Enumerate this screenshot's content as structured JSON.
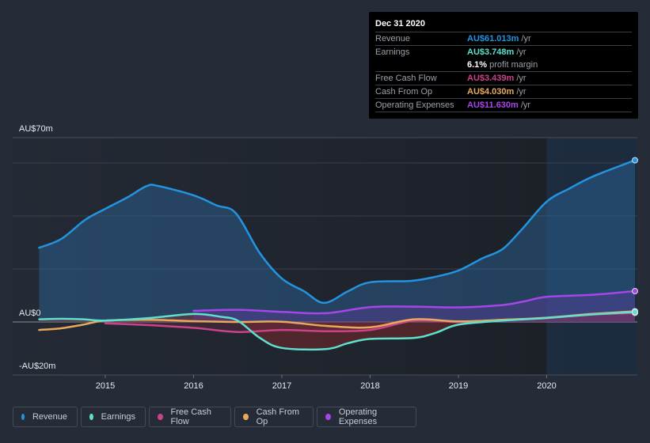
{
  "tooltip": {
    "date": "Dec 31 2020",
    "rows": [
      {
        "label": "Revenue",
        "value": "AU$61.013m",
        "unit": "/yr",
        "color": "#2394df"
      },
      {
        "label": "Earnings",
        "value": "AU$3.748m",
        "unit": "/yr",
        "color": "#5fe0cf"
      },
      {
        "label": "",
        "margin_value": "6.1%",
        "margin_label": "profit margin"
      },
      {
        "label": "Free Cash Flow",
        "value": "AU$3.439m",
        "unit": "/yr",
        "color": "#c9428a"
      },
      {
        "label": "Cash From Op",
        "value": "AU$4.030m",
        "unit": "/yr",
        "color": "#e8a95c"
      },
      {
        "label": "Operating Expenses",
        "value": "AU$11.630m",
        "unit": "/yr",
        "color": "#a646e8"
      }
    ]
  },
  "legend": [
    {
      "label": "Revenue",
      "color": "#2394df"
    },
    {
      "label": "Earnings",
      "color": "#5fe0cf"
    },
    {
      "label": "Free Cash Flow",
      "color": "#c9428a"
    },
    {
      "label": "Cash From Op",
      "color": "#e8a95c"
    },
    {
      "label": "Operating Expenses",
      "color": "#a646e8"
    }
  ],
  "chart_data": {
    "type": "line",
    "title": "",
    "xlabel": "",
    "ylabel": "",
    "y_tick_labels": [
      "AU$70m",
      "AU$0",
      "-AU$20m"
    ],
    "y_ticks": [
      70,
      0,
      -20
    ],
    "ylim": [
      -20,
      70
    ],
    "gridlines_y": [
      60,
      40,
      20,
      0
    ],
    "x_tick_labels": [
      "2015",
      "2016",
      "2017",
      "2018",
      "2019",
      "2020"
    ],
    "x_ticks": [
      2015,
      2016,
      2017,
      2018,
      2019,
      2020
    ],
    "xlim": [
      2014.23,
      2021.05
    ],
    "highlight_start": 2020.0,
    "grid": true,
    "legend_position": "bottom-left",
    "series": [
      {
        "name": "Revenue",
        "color": "#2394df",
        "fill": true,
        "x": [
          2014.25,
          2014.5,
          2014.77,
          2015.0,
          2015.25,
          2015.47,
          2015.6,
          2016.0,
          2016.26,
          2016.48,
          2016.75,
          2017.0,
          2017.25,
          2017.48,
          2017.75,
          2018.0,
          2018.46,
          2018.73,
          2019.0,
          2019.27,
          2019.5,
          2019.72,
          2020.0,
          2020.26,
          2020.53,
          2021.0
        ],
        "values": [
          28,
          31.3,
          38.5,
          42.7,
          47,
          51.3,
          51.3,
          47.8,
          44,
          41,
          26,
          16.4,
          11.6,
          7.2,
          11.6,
          15,
          15.5,
          17,
          19.4,
          24,
          27.5,
          35,
          45.4,
          50.4,
          55,
          61.013
        ]
      },
      {
        "name": "Earnings",
        "color": "#5fe0cf",
        "fill": true,
        "x": [
          2014.25,
          2014.5,
          2014.75,
          2015.0,
          2015.5,
          2016.0,
          2016.3,
          2016.5,
          2016.75,
          2017.0,
          2017.5,
          2017.75,
          2018.0,
          2018.5,
          2018.75,
          2019.0,
          2019.5,
          2020.0,
          2020.5,
          2021.0
        ],
        "values": [
          1,
          1.2,
          1,
          0.5,
          1.5,
          3,
          2,
          0.5,
          -6,
          -9.8,
          -10.2,
          -8,
          -6.4,
          -6,
          -4,
          -1,
          0.5,
          1.5,
          2.8,
          3.748
        ]
      },
      {
        "name": "Free Cash Flow",
        "color": "#c9428a",
        "fill": true,
        "x": [
          2015.0,
          2015.5,
          2016.0,
          2016.5,
          2017.0,
          2017.5,
          2018.0,
          2018.5,
          2019.0,
          2019.5,
          2020.0,
          2020.5,
          2021.0
        ],
        "values": [
          -0.5,
          -1.2,
          -2.2,
          -3.8,
          -3,
          -3.5,
          -3,
          0.5,
          0,
          0.8,
          1.5,
          2.8,
          3.439
        ]
      },
      {
        "name": "Cash From Op",
        "color": "#e8a95c",
        "fill": false,
        "x": [
          2014.25,
          2014.5,
          2014.75,
          2015.0,
          2015.5,
          2016.0,
          2016.5,
          2017.0,
          2017.5,
          2018.0,
          2018.5,
          2019.0,
          2019.5,
          2020.0,
          2020.5,
          2021.0
        ],
        "values": [
          -3,
          -2.4,
          -1,
          0.5,
          0.8,
          0.3,
          0,
          0.1,
          -1.5,
          -2,
          1,
          0.2,
          0.8,
          1.6,
          3,
          4.03
        ]
      },
      {
        "name": "Operating Expenses",
        "color": "#a646e8",
        "fill": true,
        "x": [
          2016.0,
          2016.5,
          2017.0,
          2017.5,
          2018.0,
          2018.5,
          2019.0,
          2019.5,
          2019.75,
          2020.0,
          2020.5,
          2021.0
        ],
        "values": [
          4.2,
          4.6,
          3.8,
          3.3,
          5.6,
          5.8,
          5.5,
          6.4,
          7.8,
          9.5,
          10.2,
          11.63
        ]
      }
    ]
  }
}
